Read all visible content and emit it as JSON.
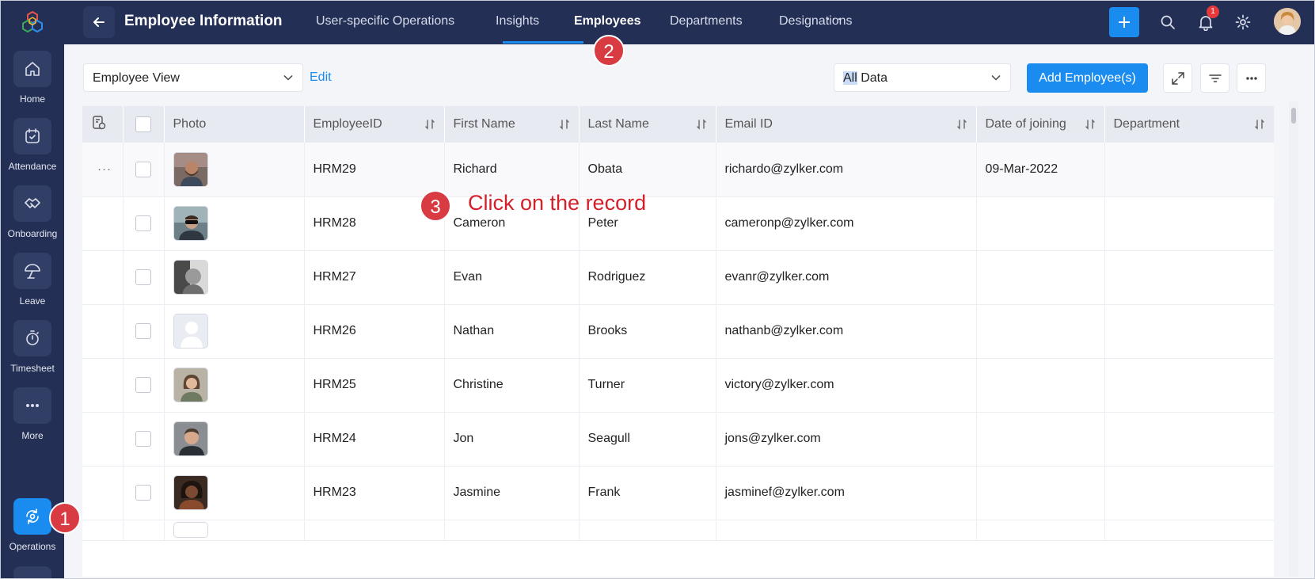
{
  "sidebar": {
    "items": [
      {
        "label": "Home",
        "icon": "home-icon"
      },
      {
        "label": "Attendance",
        "icon": "calendar-check-icon"
      },
      {
        "label": "Onboarding",
        "icon": "handshake-icon"
      },
      {
        "label": "Leave",
        "icon": "umbrella-icon"
      },
      {
        "label": "Timesheet",
        "icon": "stopwatch-icon"
      },
      {
        "label": "More",
        "icon": "more-dots-icon"
      },
      {
        "label": "Operations",
        "icon": "operations-icon",
        "active": true
      }
    ]
  },
  "topbar": {
    "title": "Employee Information",
    "tabs": [
      "User-specific Operations",
      "Insights",
      "Employees",
      "Departments",
      "Designations"
    ],
    "active_tab": "Employees",
    "more_label": "···",
    "notification_count": "1"
  },
  "toolbar": {
    "view_value": "Employee View",
    "edit_label": "Edit",
    "filter_value_highlight": "All",
    "filter_value_rest": " Data",
    "add_button_label": "Add Employee(s)"
  },
  "table": {
    "columns": [
      "Photo",
      "EmployeeID",
      "First Name",
      "Last Name",
      "Email ID",
      "Date of joining",
      "Department"
    ],
    "rows": [
      {
        "id": "HRM29",
        "first": "Richard",
        "last": "Obata",
        "email": "richardo@zylker.com",
        "doj": "09-Mar-2022",
        "dept": ""
      },
      {
        "id": "HRM28",
        "first": "Cameron",
        "last": "Peter",
        "email": "cameronp@zylker.com",
        "doj": "",
        "dept": ""
      },
      {
        "id": "HRM27",
        "first": "Evan",
        "last": "Rodriguez",
        "email": "evanr@zylker.com",
        "doj": "",
        "dept": ""
      },
      {
        "id": "HRM26",
        "first": "Nathan",
        "last": "Brooks",
        "email": "nathanb@zylker.com",
        "doj": "",
        "dept": ""
      },
      {
        "id": "HRM25",
        "first": "Christine",
        "last": "Turner",
        "email": "victory@zylker.com",
        "doj": "",
        "dept": ""
      },
      {
        "id": "HRM24",
        "first": "Jon",
        "last": "Seagull",
        "email": "jons@zylker.com",
        "doj": "",
        "dept": ""
      },
      {
        "id": "HRM23",
        "first": "Jasmine",
        "last": "Frank",
        "email": "jasminef@zylker.com",
        "doj": "",
        "dept": ""
      }
    ],
    "row_menu": "···"
  },
  "annotations": {
    "step1": "1",
    "step2": "2",
    "step3": "3",
    "callout": "Click on the record"
  },
  "colors": {
    "nav_bg": "#232f55",
    "accent": "#1a8cf0",
    "annotation_red": "#d83b41"
  }
}
